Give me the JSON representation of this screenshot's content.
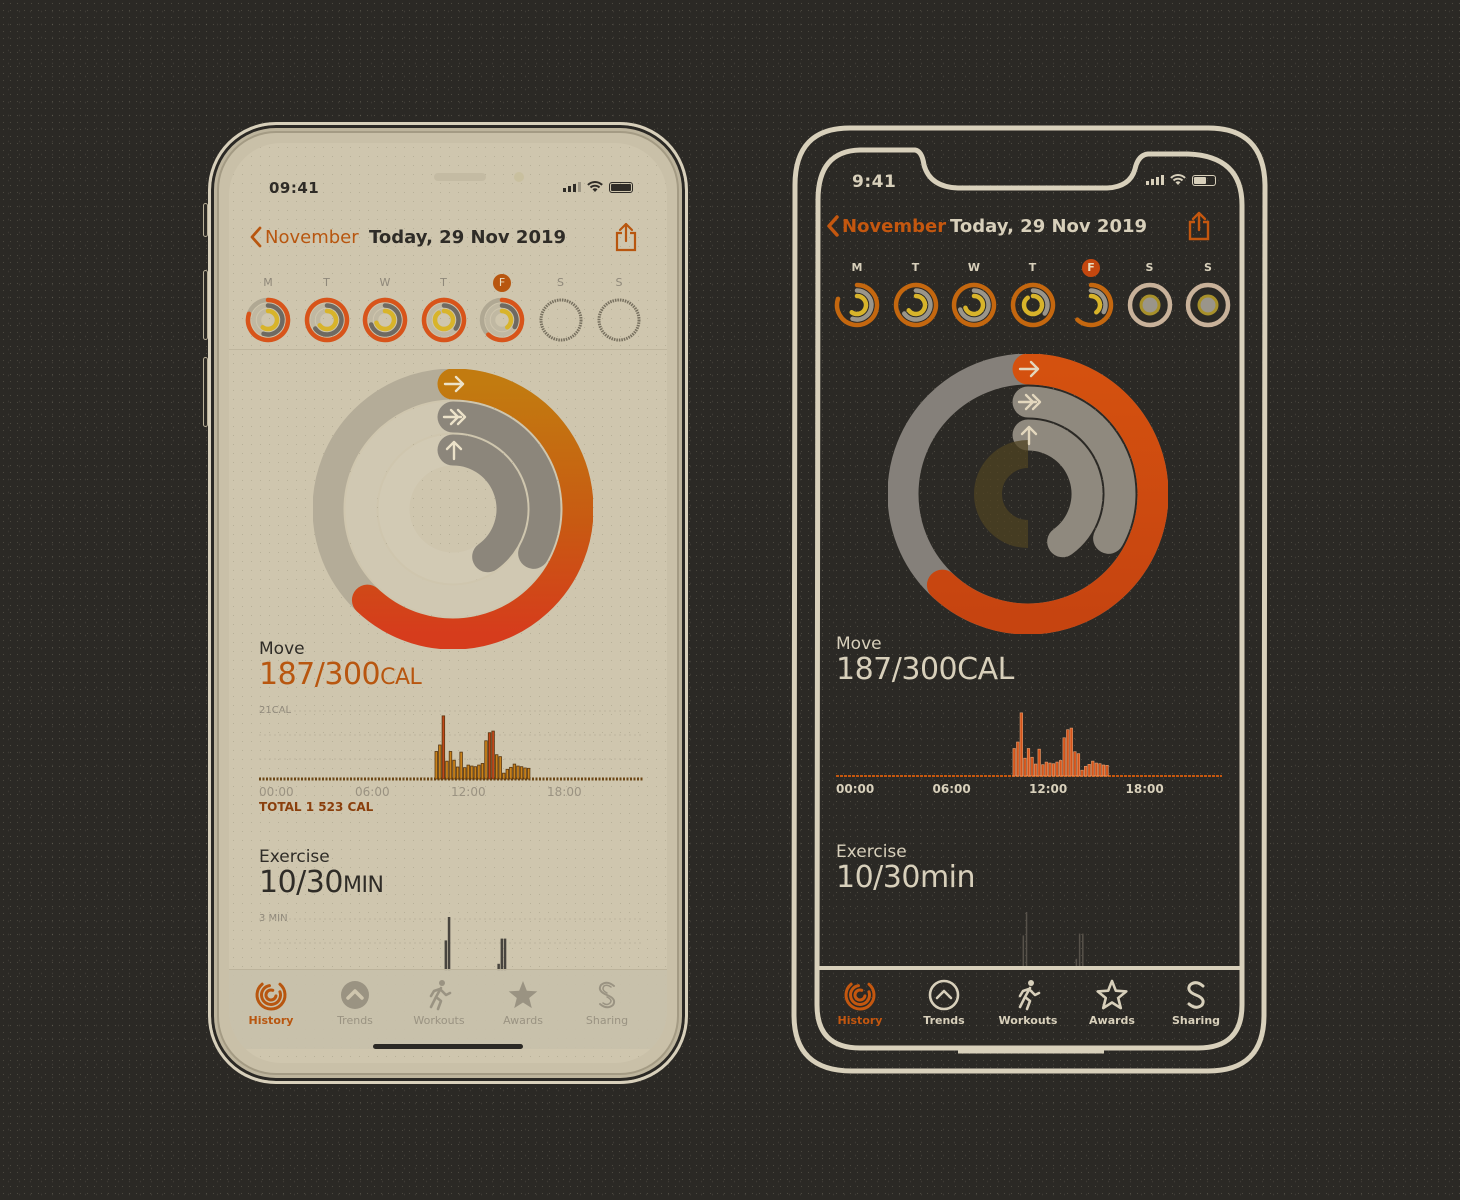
{
  "colors": {
    "accent_orange": "#c4570f",
    "move_red": "#d84418",
    "move_amber": "#c98a12",
    "dark_bg": "#2b2925",
    "cream": "#d8d0bb",
    "light_screen": "#cfc6ae",
    "light_text": "#2f2c27",
    "muted_gray": "#8f887a",
    "exercise_gray": "#8c867b",
    "stand_yellow": "#d8b42a"
  },
  "light_phone": {
    "status": {
      "time": "09:41"
    },
    "nav": {
      "back_label": "November",
      "title": "Today, 29 Nov 2019"
    },
    "week": {
      "days": [
        {
          "letter": "M",
          "move": 0.8,
          "exercise": 0.55,
          "stand": 0.6,
          "selected": false
        },
        {
          "letter": "T",
          "move": 1.0,
          "exercise": 0.65,
          "stand": 0.65,
          "selected": false
        },
        {
          "letter": "W",
          "move": 1.0,
          "exercise": 0.7,
          "stand": 0.7,
          "selected": false
        },
        {
          "letter": "T",
          "move": 1.0,
          "exercise": 0.35,
          "stand": 0.9,
          "selected": false
        },
        {
          "letter": "F",
          "move": 0.62,
          "exercise": 0.33,
          "stand": 0.4,
          "selected": true
        },
        {
          "letter": "S",
          "move": 0,
          "exercise": 0,
          "stand": 0,
          "selected": false
        },
        {
          "letter": "S",
          "move": 0,
          "exercise": 0,
          "stand": 0,
          "selected": false
        }
      ]
    },
    "rings": {
      "move": 0.62,
      "exercise": 0.33,
      "stand": 0.4
    },
    "move": {
      "label": "Move",
      "value": "187/300",
      "unit": "CAL",
      "chart_max_label": "21CAL",
      "total_label": "TOTAL 1 523 CAL"
    },
    "exercise": {
      "label": "Exercise",
      "value": "10/30",
      "unit": "MIN",
      "chart_max_label": "3 MIN"
    },
    "tabs": [
      {
        "label": "History",
        "icon": "history-rings-icon",
        "active": true
      },
      {
        "label": "Trends",
        "icon": "trends-chevron-icon",
        "active": false
      },
      {
        "label": "Workouts",
        "icon": "runner-icon",
        "active": false
      },
      {
        "label": "Awards",
        "icon": "award-star-icon",
        "active": false
      },
      {
        "label": "Sharing",
        "icon": "sharing-s-icon",
        "active": false
      }
    ]
  },
  "dark_phone": {
    "status": {
      "time": "9:41"
    },
    "nav": {
      "back_label": "November",
      "title": "Today, 29 Nov 2019"
    },
    "week": {
      "days": [
        {
          "letter": "M",
          "selected": false
        },
        {
          "letter": "T",
          "selected": false
        },
        {
          "letter": "W",
          "selected": false
        },
        {
          "letter": "T",
          "selected": false
        },
        {
          "letter": "F",
          "selected": true
        },
        {
          "letter": "S",
          "selected": false
        },
        {
          "letter": "S",
          "selected": false
        }
      ]
    },
    "move": {
      "label": "Move",
      "value": "187/300CAL"
    },
    "exercise": {
      "label": "Exercise",
      "value": "10/30min"
    },
    "tabs": [
      {
        "label": "History",
        "active": true
      },
      {
        "label": "Trends",
        "active": false
      },
      {
        "label": "Workouts",
        "active": false
      },
      {
        "label": "Awards",
        "active": false
      },
      {
        "label": "Sharing",
        "active": false
      }
    ]
  },
  "chart_data": [
    {
      "type": "bar",
      "title": "Move",
      "ylabel": "CAL",
      "ylim": [
        0,
        21
      ],
      "x_tick_labels": [
        "00:00",
        "06:00",
        "12:00",
        "18:00"
      ],
      "xlim_hours": [
        0,
        24
      ],
      "bar_start_hour": 11.0,
      "bar_step_hours": 0.222,
      "values": [
        8.5,
        10.5,
        19.5,
        5.5,
        8.5,
        5.8,
        3.7,
        8.3,
        3.5,
        4.3,
        4.0,
        3.8,
        4.3,
        4.8,
        11.8,
        14.3,
        14.8,
        7.5,
        6.9,
        1.8,
        3.0,
        3.6,
        4.6,
        4.0,
        3.8,
        3.4,
        3.3
      ],
      "grid": true
    },
    {
      "type": "bar",
      "title": "Exercise",
      "ylabel": "MIN",
      "ylim": [
        0,
        3
      ],
      "bar_hours": [
        11.6,
        11.8,
        14.9,
        15.1,
        15.3
      ],
      "values": [
        1.7,
        3.0,
        0.4,
        1.8,
        1.8
      ]
    }
  ]
}
